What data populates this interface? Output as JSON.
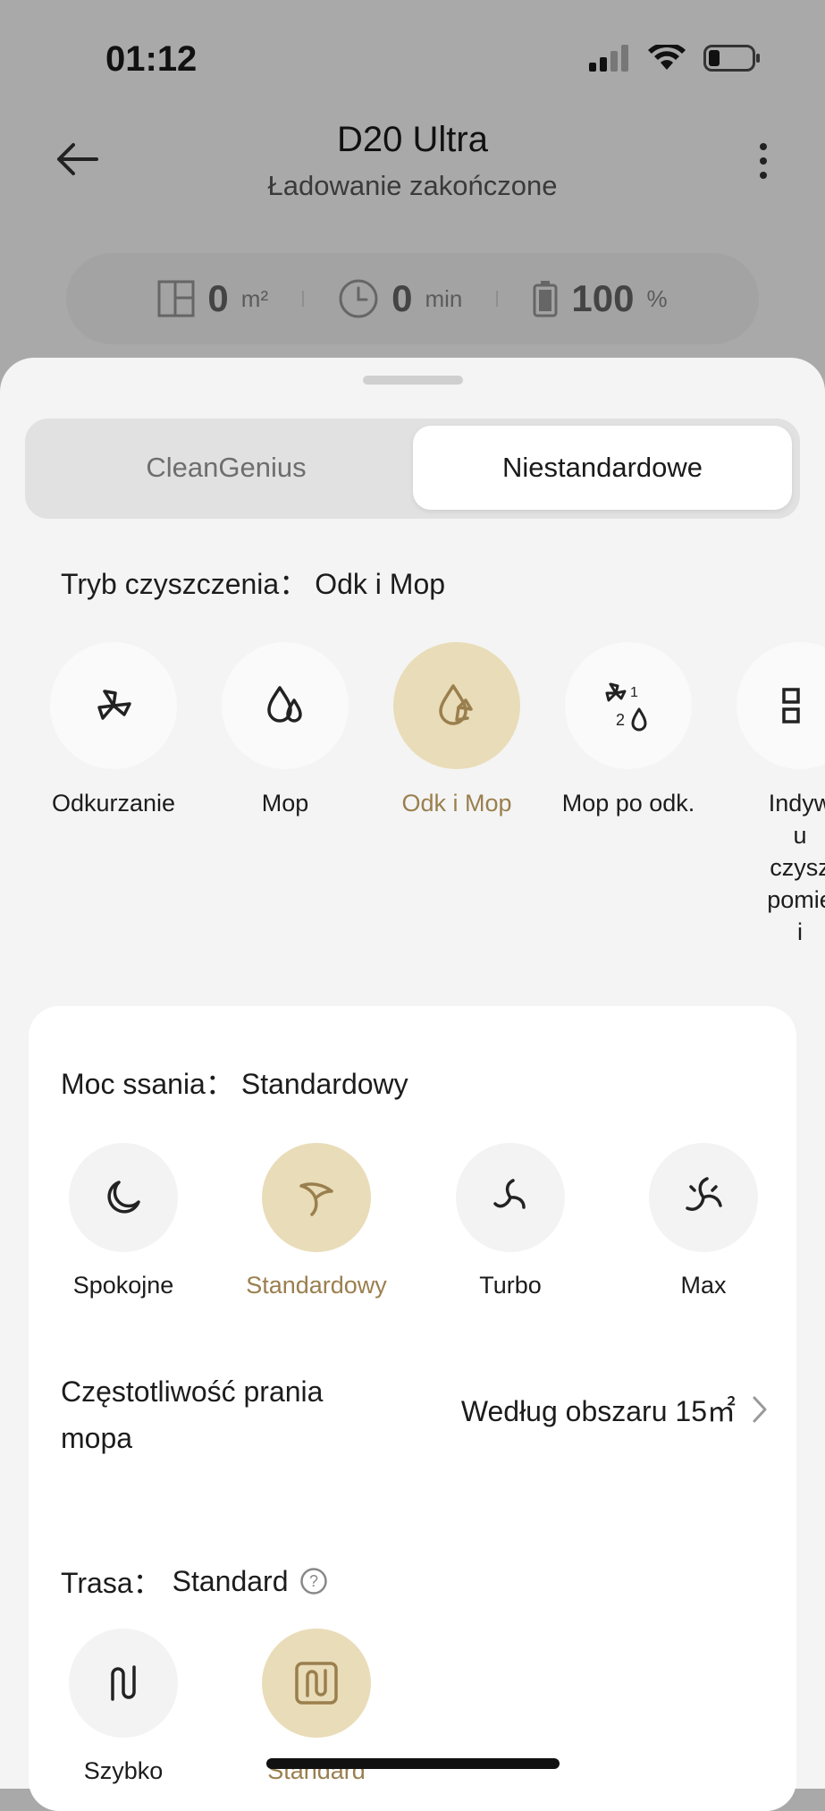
{
  "status": {
    "time": "01:12"
  },
  "header": {
    "title": "D20 Ultra",
    "subtitle": "Ładowanie zakończone"
  },
  "stats": [
    {
      "icon": "area-icon",
      "value": "0",
      "unit": "m²"
    },
    {
      "icon": "clock-icon",
      "value": "0",
      "unit": "min"
    },
    {
      "icon": "battery-icon",
      "value": "100",
      "unit": "%"
    }
  ],
  "tabs": [
    {
      "label": "CleanGenius",
      "selected": false
    },
    {
      "label": "Niestandardowe",
      "selected": true
    }
  ],
  "cleaning_mode": {
    "label": "Tryb czyszczenia：",
    "value": "Odk i Mop",
    "options": [
      {
        "label": "Odkurzanie",
        "icon": "vacuum-icon",
        "selected": false
      },
      {
        "label": "Mop",
        "icon": "mop-drops-icon",
        "selected": false
      },
      {
        "label": "Odk i Mop",
        "icon": "vacuum-mop-icon",
        "selected": true
      },
      {
        "label": "Mop po odk.",
        "icon": "mop-after-vacuum-icon",
        "selected": false
      },
      {
        "label": "Indyw\nu\nczysz\npomie\ni",
        "icon": "custom-room-icon",
        "selected": false
      }
    ]
  },
  "suction": {
    "label": "Moc ssania：",
    "value": "Standardowy",
    "options": [
      {
        "label": "Spokojne",
        "icon": "quiet-icon",
        "selected": false
      },
      {
        "label": "Standardowy",
        "icon": "standard-fan-icon",
        "selected": true
      },
      {
        "label": "Turbo",
        "icon": "turbo-fan-icon",
        "selected": false
      },
      {
        "label": "Max",
        "icon": "max-fan-icon",
        "selected": false
      }
    ]
  },
  "mop_wash": {
    "label": "Częstotliwość prania mopa",
    "value": "Według obszaru 15㎡"
  },
  "route": {
    "label": "Trasa：",
    "value": "Standard",
    "options": [
      {
        "label": "Szybko",
        "icon": "fast-route-icon",
        "selected": false
      },
      {
        "label": "Standard",
        "icon": "standard-route-icon",
        "selected": true
      }
    ]
  },
  "colors": {
    "accent": "#9a7f4e",
    "selected_bg": "#e9dcb8"
  }
}
